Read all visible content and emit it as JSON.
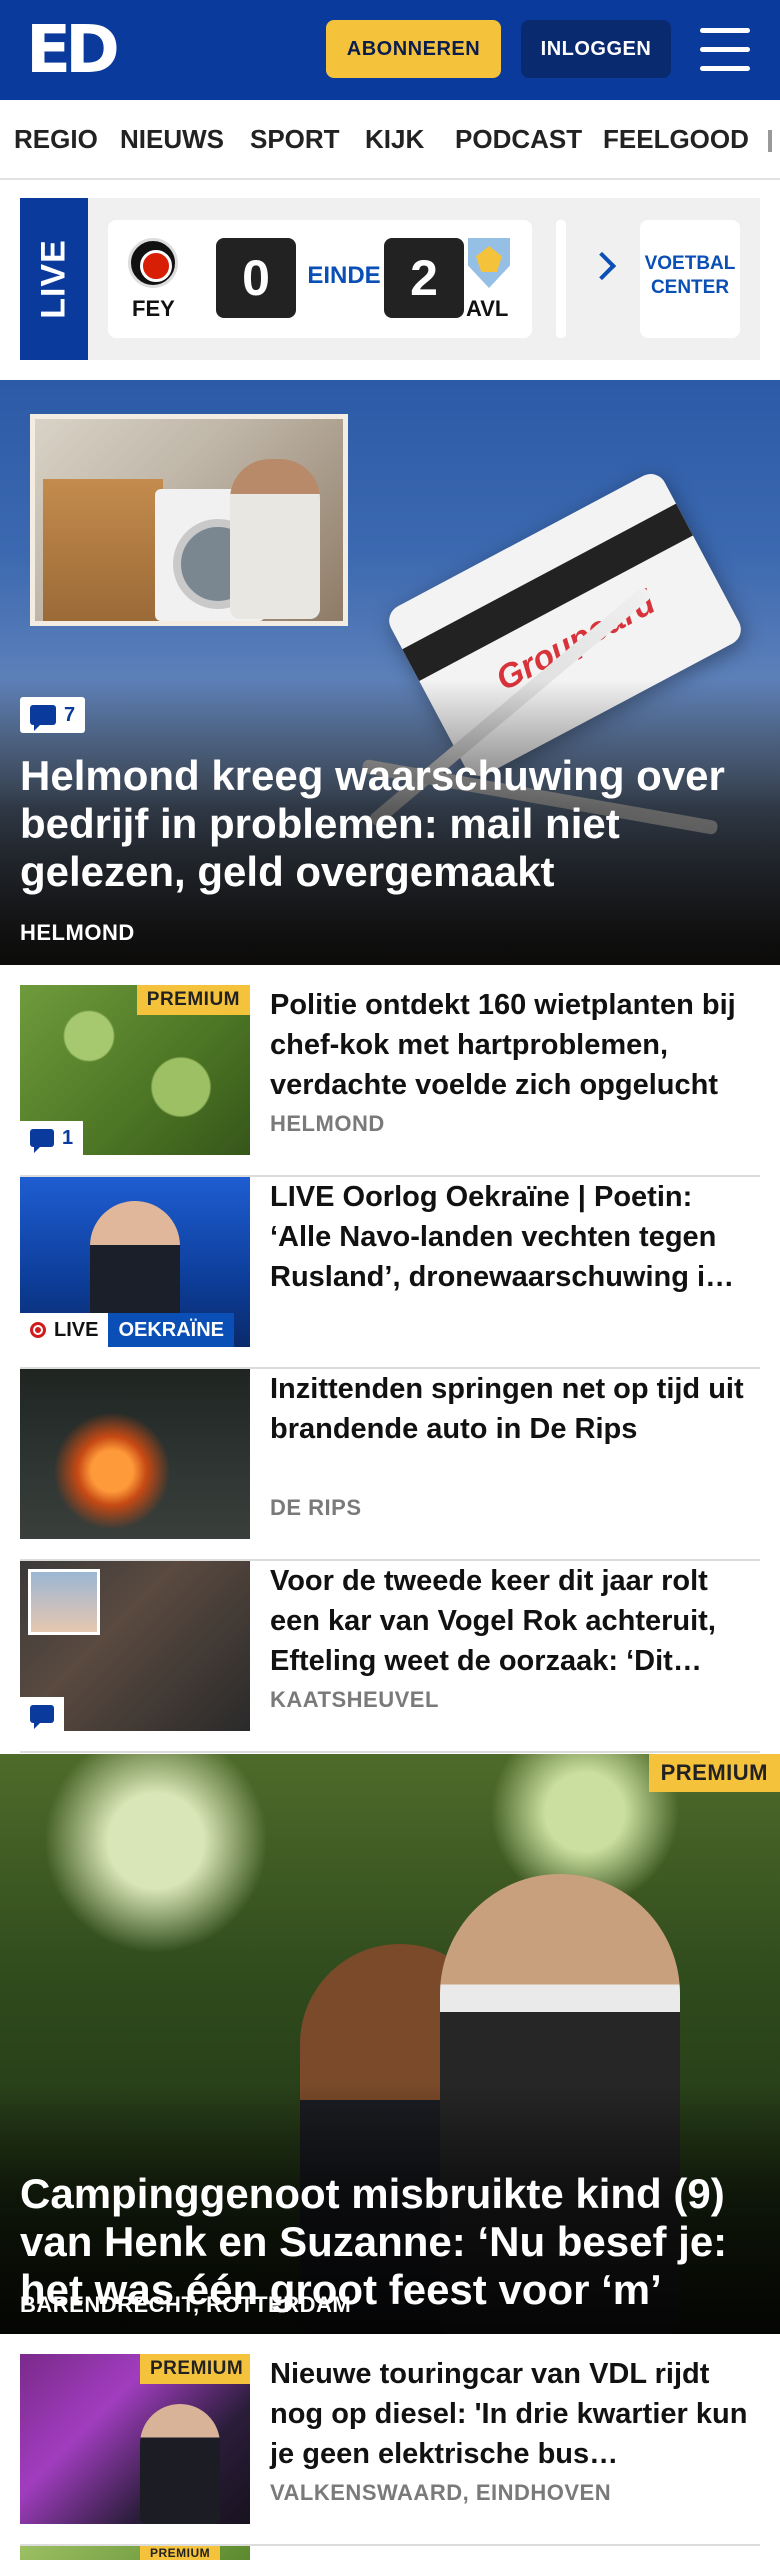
{
  "header": {
    "logo": "ED",
    "subscribe_label": "ABONNEREN",
    "login_label": "INLOGGEN"
  },
  "nav": {
    "items": [
      "REGIO",
      "NIEUWS",
      "SPORT",
      "KIJK",
      "PODCAST",
      "FEELGOOD"
    ]
  },
  "live": {
    "tag": "LIVE",
    "match": {
      "home": "FEY",
      "home_score": "0",
      "status": "EINDE",
      "away_score": "2",
      "away": "AVL"
    },
    "voetbal_center": "VOETBAL CENTER"
  },
  "hero": {
    "comments": "7",
    "title": "Helmond kreeg waarschuwing over bedrijf in problemen: mail niet gelezen, geld overgemaakt",
    "location": "HELMOND",
    "card_logo": "Groupcard"
  },
  "articles": [
    {
      "title": "Politie ontdekt 160 wietplanten bij chef-kok met hartproblemen, verdachte voelde zich opgelucht",
      "location": "HELMOND",
      "premium": "PREMIUM",
      "comments": "1"
    },
    {
      "title": "LIVE Oorlog Oekraïne | Poetin: ‘Alle Navo-landen vechten tegen Rusland’, dronewaarschuwing i…",
      "live_label": "LIVE",
      "tag": "OEKRAÏNE"
    },
    {
      "title": "Inzittenden springen net op tijd uit brandende auto in De Rips",
      "location": "DE RIPS"
    },
    {
      "title": "Voor de tweede keer dit jaar rolt een kar van Vogel Rok achteruit, Efteling weet de oorzaak: ‘Dit…",
      "location": "KAATSHEUVEL"
    }
  ],
  "hero2": {
    "premium": "PREMIUM",
    "title": "Campinggenoot misbruikte kind (9) van Henk en Suzanne: ‘Nu besef je: het was één groot feest voor ‘m’",
    "location": "BARENDRECHT, ROTTERDAM"
  },
  "articles2": [
    {
      "title": "Nieuwe touringcar van VDL rijdt nog op diesel: 'In drie kwartier kun je geen elektrische bus…",
      "location": "VALKENSWAARD, EINDHOVEN",
      "premium": "PREMIUM"
    },
    {
      "premium": "PREMIUM"
    }
  ],
  "colors": {
    "brand_blue": "#0a3b9c",
    "accent_yellow": "#f5c23c",
    "link_blue": "#0a4fb5"
  }
}
